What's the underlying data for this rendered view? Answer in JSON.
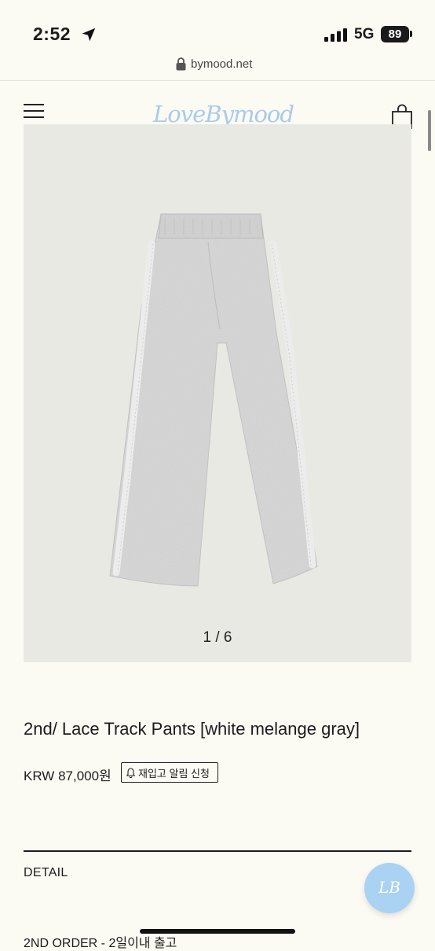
{
  "status_bar": {
    "time": "2:52",
    "network": "5G",
    "battery": "89"
  },
  "browser": {
    "url": "bymood.net"
  },
  "header": {
    "logo": "LoveBymood"
  },
  "gallery": {
    "current_index": 1,
    "total": 6,
    "counter_text": "1 / 6"
  },
  "product": {
    "title": "2nd/ Lace Track Pants [white melange gray]",
    "price": "KRW 87,000원",
    "restock_label": "재입고 알림 신청"
  },
  "sections": {
    "detail_label": "DETAIL",
    "order_info": "2ND ORDER - 2일이내 출고"
  },
  "fab": {
    "label": "LB"
  },
  "colors": {
    "background": "#fbfaf3",
    "logo": "#aacbea",
    "fab": "#a9d2f3",
    "gallery_bg": "#e9e9e4",
    "product_fabric": "#d6d6d6"
  },
  "icons": [
    "location-arrow-icon",
    "signal-icon",
    "lock-icon",
    "menu-icon",
    "shopping-bag-icon",
    "bell-icon"
  ]
}
